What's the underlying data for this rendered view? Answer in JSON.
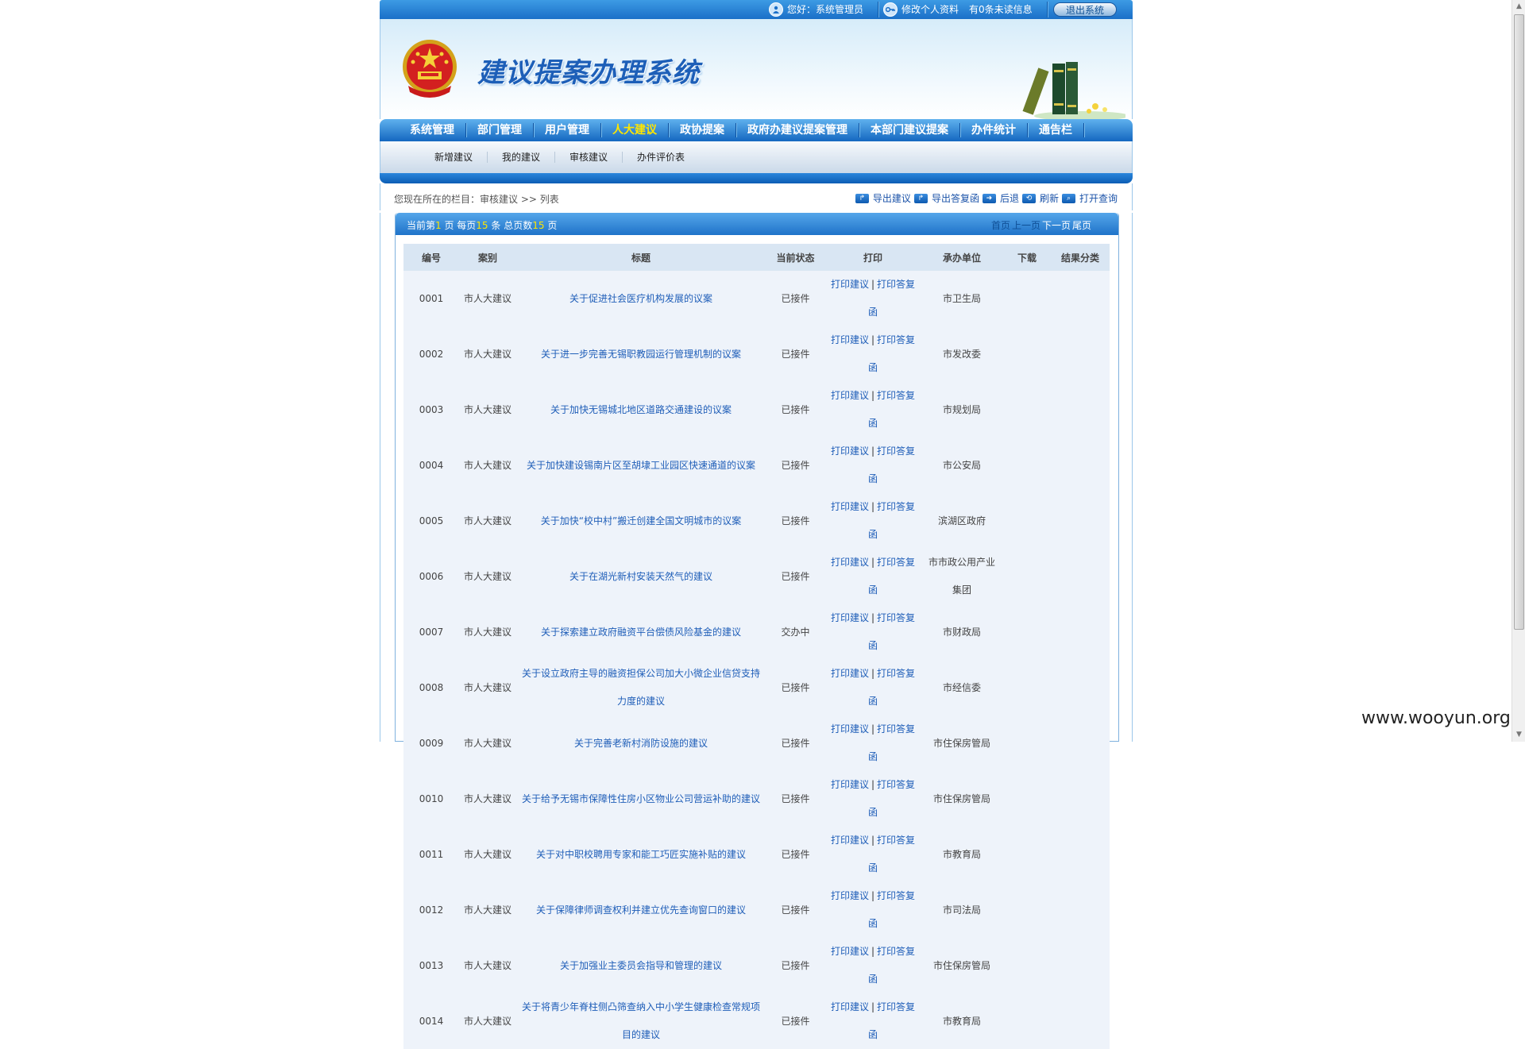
{
  "topbar": {
    "greeting": "您好：系统管理员",
    "edit_profile": "修改个人资料",
    "unread": "有0条未读信息",
    "logout": "退出系统"
  },
  "banner": {
    "system_name": "建议提案办理系统"
  },
  "nav": {
    "items": [
      {
        "label": "系统管理",
        "active": false
      },
      {
        "label": "部门管理",
        "active": false
      },
      {
        "label": "用户管理",
        "active": false
      },
      {
        "label": "人大建议",
        "active": true
      },
      {
        "label": "政协提案",
        "active": false
      },
      {
        "label": "政府办建议提案管理",
        "active": false
      },
      {
        "label": "本部门建议提案",
        "active": false
      },
      {
        "label": "办件统计",
        "active": false
      },
      {
        "label": "通告栏",
        "active": false
      }
    ],
    "subitems": [
      "新增建议",
      "我的建议",
      "审核建议",
      "办件评价表"
    ]
  },
  "location": {
    "text": "您现在所在的栏目：审核建议 >> 列表"
  },
  "tools": {
    "export_suggestion": "导出建议",
    "export_reply": "导出答复函",
    "back": "后退",
    "refresh": "刷新",
    "open_query": "打开查询"
  },
  "pagebar": {
    "prefix": "当前第",
    "current_page": "1",
    "mid1": " 页 每页",
    "per_page": "15",
    "mid2": " 条 总页数",
    "total_pages": "15",
    "suffix": " 页",
    "first": "首页",
    "prev": "上一页",
    "next": "下一页",
    "last": "尾页"
  },
  "table": {
    "headers": [
      "编号",
      "案别",
      "标题",
      "当前状态",
      "打印",
      "承办单位",
      "下载",
      "结果分类"
    ],
    "print_suggestion": "打印建议",
    "print_sep": "|",
    "print_reply": "打印答复函",
    "rows": [
      {
        "id": "0001",
        "type": "市人大建议",
        "title": "关于促进社会医疗机构发展的议案",
        "status": "已接件",
        "unit": "市卫生局"
      },
      {
        "id": "0002",
        "type": "市人大建议",
        "title": "关于进一步完善无锡职教园运行管理机制的议案",
        "status": "已接件",
        "unit": "市发改委"
      },
      {
        "id": "0003",
        "type": "市人大建议",
        "title": "关于加快无锡城北地区道路交通建设的议案",
        "status": "已接件",
        "unit": "市规划局"
      },
      {
        "id": "0004",
        "type": "市人大建议",
        "title": "关于加快建设锡南片区至胡埭工业园区快速通道的议案",
        "status": "已接件",
        "unit": "市公安局"
      },
      {
        "id": "0005",
        "type": "市人大建议",
        "title": "关于加快“校中村”搬迁创建全国文明城市的议案",
        "status": "已接件",
        "unit": "滨湖区政府"
      },
      {
        "id": "0006",
        "type": "市人大建议",
        "title": "关于在湖光新村安装天然气的建议",
        "status": "已接件",
        "unit": "市市政公用产业集团"
      },
      {
        "id": "0007",
        "type": "市人大建议",
        "title": "关于探索建立政府融资平台偿债风险基金的建议",
        "status": "交办中",
        "unit": "市财政局"
      },
      {
        "id": "0008",
        "type": "市人大建议",
        "title": "关于设立政府主导的融资担保公司加大小微企业信贷支持力度的建议",
        "status": "已接件",
        "unit": "市经信委"
      },
      {
        "id": "0009",
        "type": "市人大建议",
        "title": "关于完善老新村消防设施的建议",
        "status": "已接件",
        "unit": "市住保房管局"
      },
      {
        "id": "0010",
        "type": "市人大建议",
        "title": "关于给予无锡市保障性住房小区物业公司营运补助的建议",
        "status": "已接件",
        "unit": "市住保房管局"
      },
      {
        "id": "0011",
        "type": "市人大建议",
        "title": "关于对中职校聘用专家和能工巧匠实施补贴的建议",
        "status": "已接件",
        "unit": "市教育局"
      },
      {
        "id": "0012",
        "type": "市人大建议",
        "title": "关于保障律师调查权利并建立优先查询窗口的建议",
        "status": "已接件",
        "unit": "市司法局"
      },
      {
        "id": "0013",
        "type": "市人大建议",
        "title": "关于加强业主委员会指导和管理的建议",
        "status": "已接件",
        "unit": "市住保房管局"
      },
      {
        "id": "0014",
        "type": "市人大建议",
        "title": "关于将青少年脊柱侧凸筛查纳入中小学生健康检查常规项目的建议",
        "status": "已接件",
        "unit": "市教育局"
      }
    ]
  },
  "watermark": "www.wooyun.org"
}
